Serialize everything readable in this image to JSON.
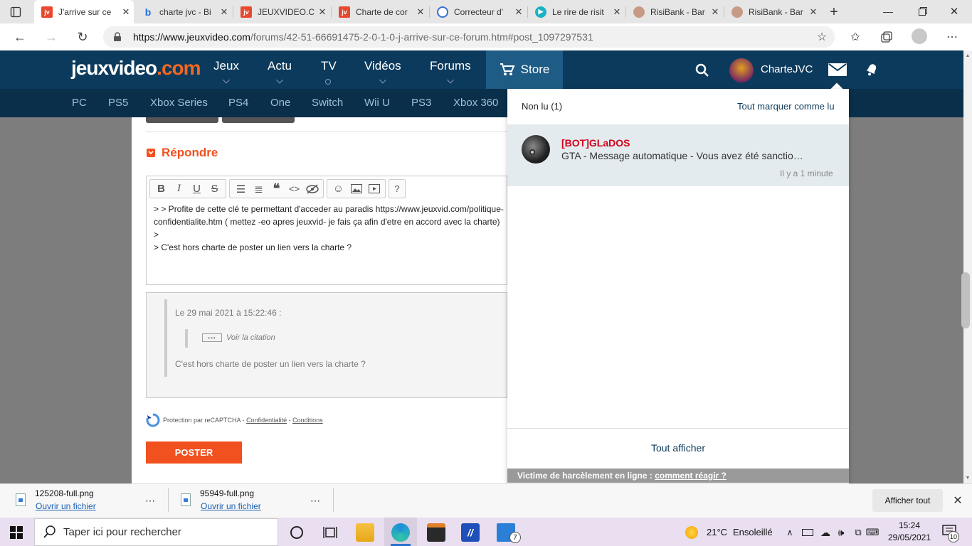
{
  "browser": {
    "tabs": [
      {
        "label": "J'arrive sur ce",
        "favicon": "jvc",
        "active": true
      },
      {
        "label": "charte jvc - Bi",
        "favicon": "bing"
      },
      {
        "label": "JEUXVIDEO.C",
        "favicon": "jvc"
      },
      {
        "label": "Charte de cor",
        "favicon": "jvc"
      },
      {
        "label": "Correcteur d'",
        "favicon": "correcteur"
      },
      {
        "label": "Le rire de risit",
        "favicon": "video"
      },
      {
        "label": "RisiBank - Bar",
        "favicon": "risibank"
      },
      {
        "label": "RisiBank - Bar",
        "favicon": "risibank"
      }
    ],
    "url_host": "https://www.jeuxvideo.com",
    "url_path": "/forums/42-51-66691475-2-0-1-0-j-arrive-sur-ce-forum.htm#post_1097297531"
  },
  "site": {
    "logo_main": "jeuxvideo",
    "logo_tld": ".com",
    "nav": [
      "Jeux",
      "Actu",
      "TV",
      "Vidéos",
      "Forums"
    ],
    "store_label": "Store",
    "username": "CharteJVC",
    "subnav": [
      "PC",
      "PS5",
      "Xbox Series",
      "PS4",
      "One",
      "Switch",
      "Wii U",
      "PS3",
      "Xbox 360"
    ]
  },
  "reply": {
    "title": "Répondre",
    "editor_lines": [
      "> > Profite de cette clé te permettant d'acceder au paradis https://www.jeuxvid.com/politique-",
      "confidentialite.htm ( mettez -eo apres jeuxvid- je fais ça afin d'etre en accord avec la charte)",
      ">",
      "> C'est hors charte de poster un lien vers la charte ?"
    ],
    "preview_date": "Le 29 mai 2021 à 15:22:46 :",
    "preview_quote": "Voir la citation",
    "preview_text": "C'est hors charte de poster un lien vers la charte ?",
    "recaptcha_prefix": "Protection par reCAPTCHA -",
    "recaptcha_privacy": "Confidentialité",
    "recaptcha_sep": "-",
    "recaptcha_terms": "Conditions",
    "post_button": "POSTER"
  },
  "dropdown": {
    "unread": "Non lu (1)",
    "mark_all": "Tout marquer comme lu",
    "notif_author": "[BOT]GLaDOS",
    "notif_text": "GTA - Message automatique - Vous avez été sanctio…",
    "notif_time": "Il y a 1 minute",
    "show_all": "Tout afficher",
    "harassment_prefix": "Victime de harcèlement en ligne :",
    "harassment_link": "comment réagir ?"
  },
  "downloads": {
    "items": [
      {
        "name": "125208-full.png",
        "open": "Ouvrir un fichier"
      },
      {
        "name": "95949-full.png",
        "open": "Ouvrir un fichier"
      }
    ],
    "show_all": "Afficher tout"
  },
  "taskbar": {
    "search_placeholder": "Taper ici pour rechercher",
    "mail_badge": "7",
    "weather_temp": "21°C",
    "weather_text": "Ensoleillé",
    "time": "15:24",
    "date": "29/05/2021",
    "notif_count": "10"
  },
  "colors": {
    "site_header": "#0c3a5c",
    "accent_orange": "#f26722",
    "post_button": "#f1501f",
    "bot_name": "#d0021b"
  }
}
